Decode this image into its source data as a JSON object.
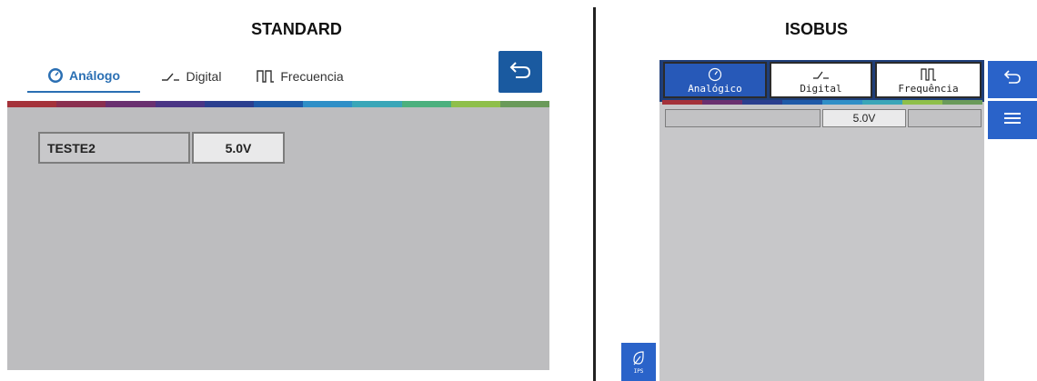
{
  "standard": {
    "heading": "STANDARD",
    "tabs": [
      {
        "label": "Análogo",
        "icon": "gauge-icon",
        "active": true
      },
      {
        "label": "Digital",
        "icon": "digital-signal-icon",
        "active": false
      },
      {
        "label": "Frecuencia",
        "icon": "pulse-wave-icon",
        "active": false
      }
    ],
    "back_icon": "back-arrow-icon",
    "row": {
      "name": "TESTE2",
      "value": "5.0V"
    }
  },
  "isobus": {
    "heading": "ISOBUS",
    "tabs": [
      {
        "label": "Analógico",
        "icon": "gauge-icon",
        "active": true
      },
      {
        "label": "Digital",
        "icon": "digital-signal-icon",
        "active": false
      },
      {
        "label": "Frequência",
        "icon": "pulse-wave-icon",
        "active": false
      }
    ],
    "row": {
      "name": "",
      "value": "5.0V",
      "extra": ""
    },
    "back_icon": "back-arrow-icon",
    "menu_icon": "menu-icon",
    "ips_label": "IPS",
    "ips_icon": "leaf-icon"
  },
  "colors": {
    "std_accent": "#2a6fb3",
    "std_back_btn": "#1a5aa0",
    "iso_active_tab": "#2759b8",
    "iso_button": "#2a63c9",
    "panel_gray": "#bdbdbf",
    "rainbow": [
      "#a4323a",
      "#7a2d5e",
      "#4a3585",
      "#2b3f8f",
      "#1f5aa8",
      "#2f8fc7",
      "#3aa6b8",
      "#5fb06a",
      "#8fbf4a",
      "#6a9a5a"
    ]
  }
}
